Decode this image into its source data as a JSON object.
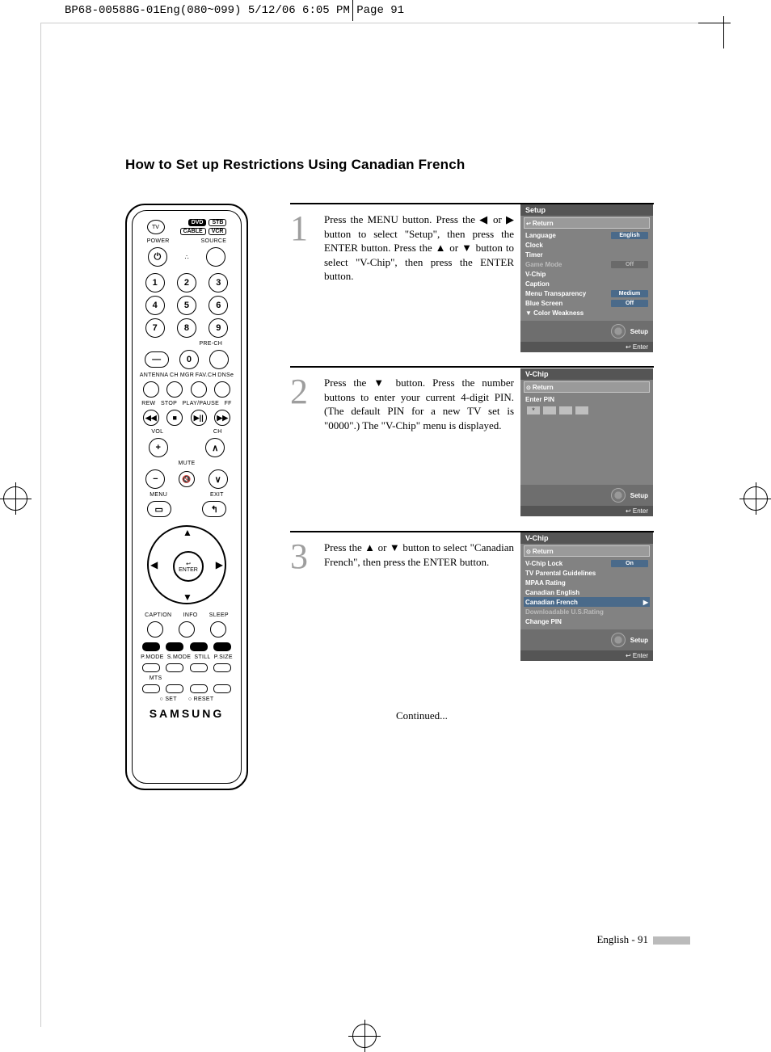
{
  "header_line": "BP68-00588G-01Eng(080~099)  5/12/06  6:05 PM  Page 91",
  "title": "How to Set up Restrictions Using Canadian French",
  "continued": "Continued...",
  "footer": "English - 91",
  "steps": {
    "s1": {
      "n": "1",
      "text": "Press the MENU button.\nPress the ◀ or ▶ button to select \"Setup\", then press the ENTER button.\nPress the ▲ or ▼ button to select \"V-Chip\", then press the ENTER button."
    },
    "s2": {
      "n": "2",
      "text": "Press the ▼ button.\nPress the number buttons to enter your current 4-digit PIN.\n(The default PIN for a new TV set is \"0000\".)\nThe \"V-Chip\" menu is displayed."
    },
    "s3": {
      "n": "3",
      "text": "Press the ▲ or ▼ button to select \"Canadian French\", then press the ENTER button."
    }
  },
  "remote": {
    "top_buttons": {
      "tv": "TV",
      "dvd": "DVD",
      "stb": "STB",
      "cable": "CABLE",
      "vcr": "VCR"
    },
    "power": "POWER",
    "source": "SOURCE",
    "digits": [
      "1",
      "2",
      "3",
      "4",
      "5",
      "6",
      "7",
      "8",
      "9",
      "0"
    ],
    "dash": "—",
    "prech": "PRE-CH",
    "row_labels": {
      "antenna": "ANTENNA",
      "chmgr": "CH MGR",
      "favch": "FAV.CH",
      "dnse": "DNSe"
    },
    "transport": {
      "rew": "REW",
      "stop": "STOP",
      "play": "PLAY/PAUSE",
      "ff": "FF",
      "sym_rew": "◀◀",
      "sym_stop": "■",
      "sym_play": "▶||",
      "sym_ff": "▶▶"
    },
    "vol": "VOL",
    "ch": "CH",
    "mute": "MUTE",
    "menu": "MENU",
    "exit": "EXIT",
    "enter": "ENTER",
    "caption": "CAPTION",
    "info": "INFO",
    "sleep": "SLEEP",
    "row2": {
      "pmode": "P.MODE",
      "smode": "S.MODE",
      "still": "STILL",
      "psize": "P.SIZE"
    },
    "mts": "MTS",
    "set": "SET",
    "reset": "RESET",
    "brand": "SAMSUNG"
  },
  "osd1": {
    "title": "Setup",
    "return": "Return",
    "rows": [
      {
        "k": "Language",
        "v": "English"
      },
      {
        "k": "Clock"
      },
      {
        "k": "Timer"
      },
      {
        "k": "Game Mode",
        "v": "Off",
        "dim": true
      },
      {
        "k": "V-Chip"
      },
      {
        "k": "Caption"
      },
      {
        "k": "Menu Transparency",
        "v": "Medium"
      },
      {
        "k": "Blue Screen",
        "v": "Off"
      }
    ],
    "more": "▼ Color Weakness",
    "foot": "Setup",
    "enter": "Enter"
  },
  "osd2": {
    "title": "V-Chip",
    "return": "Return",
    "enter_pin": "Enter PIN",
    "foot": "Setup",
    "enter": "Enter"
  },
  "osd3": {
    "title": "V-Chip",
    "return": "Return",
    "rows": [
      {
        "k": "V-Chip Lock",
        "v": "On"
      },
      {
        "k": "TV Parental Guidelines"
      },
      {
        "k": "MPAA Rating"
      },
      {
        "k": "Canadian English"
      },
      {
        "k": "Canadian French",
        "sel": true,
        "arrow": true
      },
      {
        "k": "Downloadable U.S.Rating",
        "dim": true
      },
      {
        "k": "Change PIN"
      }
    ],
    "foot": "Setup",
    "enter": "Enter"
  }
}
